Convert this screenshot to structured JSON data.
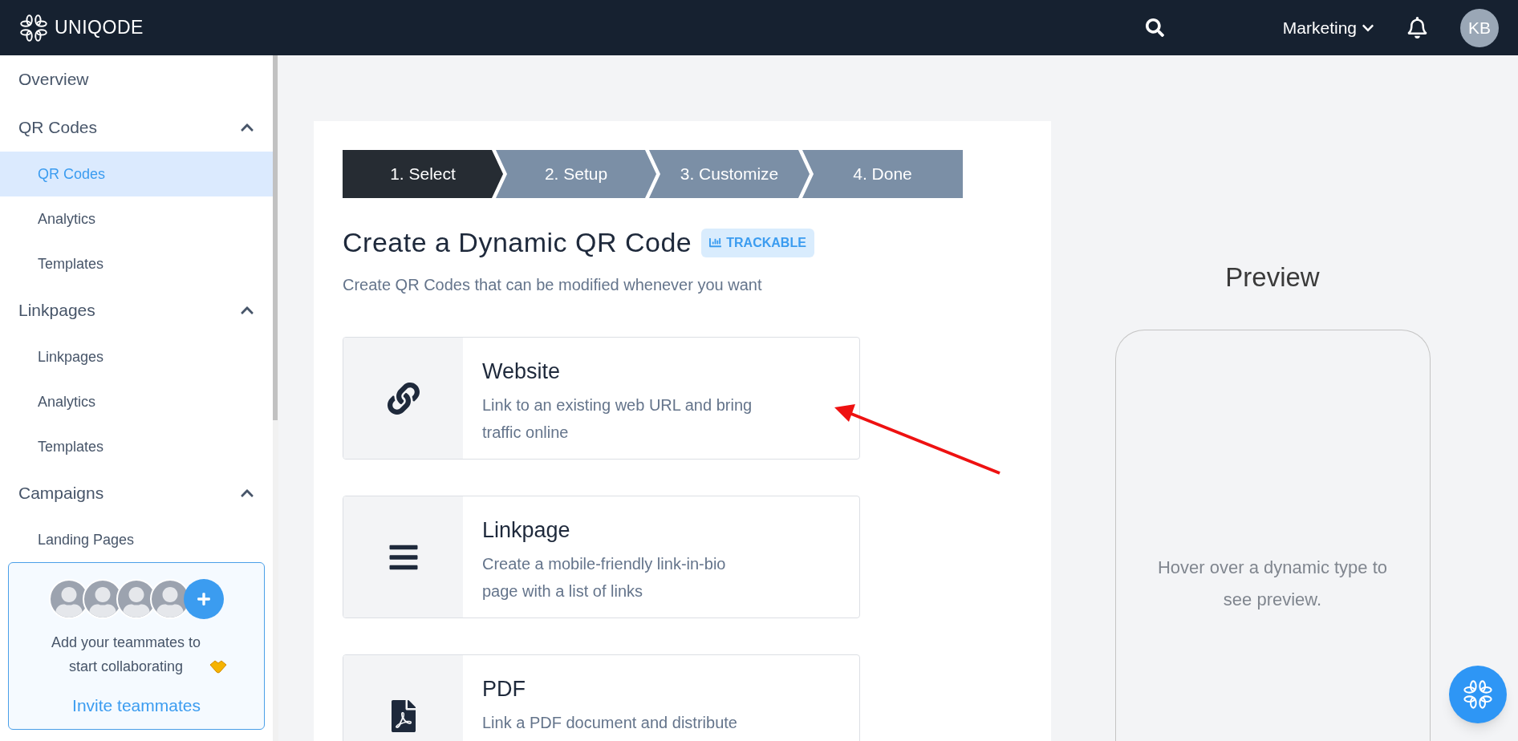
{
  "topbar": {
    "logo_text": "UNIQODE",
    "workspace": "Marketing",
    "avatar_initials": "KB"
  },
  "sidebar": {
    "sections": [
      {
        "kind": "link",
        "label": "Overview"
      },
      {
        "kind": "group",
        "label": "QR Codes",
        "expanded": true,
        "items": [
          {
            "label": "QR Codes",
            "selected": true
          },
          {
            "label": "Analytics",
            "selected": false
          },
          {
            "label": "Templates",
            "selected": false
          }
        ]
      },
      {
        "kind": "group",
        "label": "Linkpages",
        "expanded": true,
        "items": [
          {
            "label": "Linkpages",
            "selected": false
          },
          {
            "label": "Analytics",
            "selected": false
          },
          {
            "label": "Templates",
            "selected": false
          }
        ]
      },
      {
        "kind": "group",
        "label": "Campaigns",
        "expanded": true,
        "items": [
          {
            "label": "Landing Pages",
            "selected": false
          }
        ]
      }
    ],
    "invite": {
      "text": "Add your teammates to start collaborating",
      "link": "Invite teammates"
    }
  },
  "stepper": [
    {
      "label": "1. Select",
      "selected": true
    },
    {
      "label": "2. Setup",
      "selected": false
    },
    {
      "label": "3. Customize",
      "selected": false
    },
    {
      "label": "4. Done",
      "selected": false
    }
  ],
  "heading": {
    "title": "Create a Dynamic QR Code",
    "badge": "TRACKABLE",
    "subtitle": "Create QR Codes that can be modified whenever you want"
  },
  "types": [
    {
      "kind": "link",
      "title": "Website",
      "description": "Link to an existing web URL and bring traffic online"
    },
    {
      "kind": "menu",
      "title": "Linkpage",
      "description": "Create a mobile-friendly link-in-bio page with a list of links"
    },
    {
      "kind": "pdf",
      "title": "PDF",
      "description": "Link a PDF document and distribute"
    }
  ],
  "preview": {
    "title": "Preview",
    "hint": "Hover over a dynamic type to see preview."
  }
}
